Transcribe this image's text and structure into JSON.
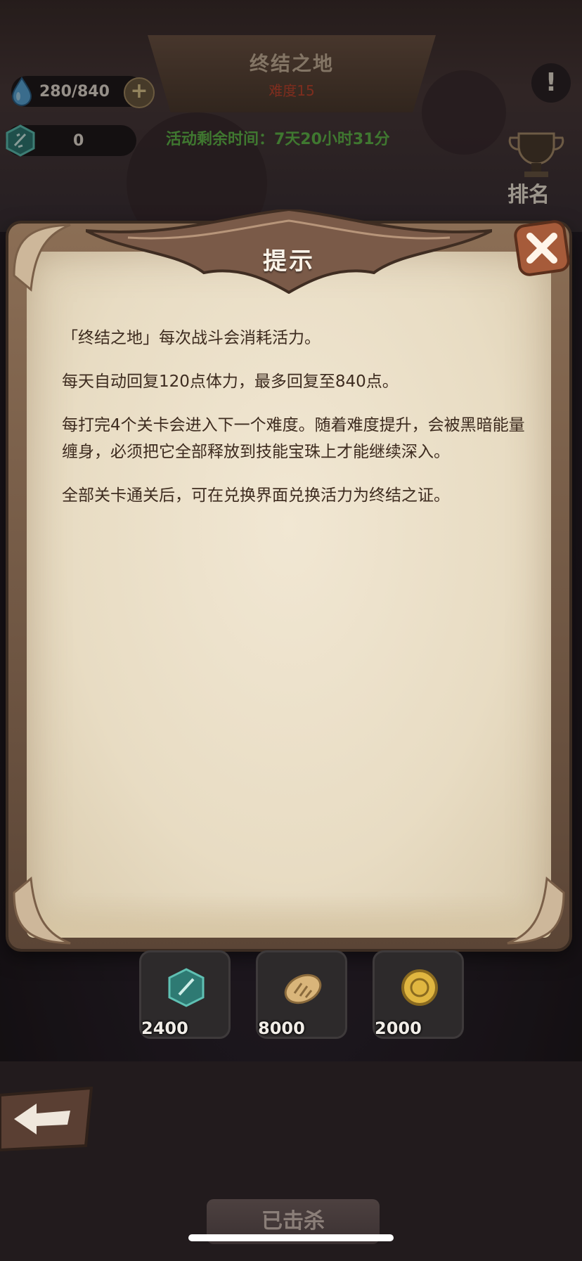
{
  "header": {
    "title": "终结之地",
    "difficulty": "难度15"
  },
  "resources": {
    "energy": "280/840",
    "energy_add": "+",
    "badge_count": "0"
  },
  "timer": "活动剩余时间：7天20小时31分",
  "alert_symbol": "!",
  "rank_label": "排名",
  "modal": {
    "title": "提示",
    "paragraphs": [
      "「终结之地」每次战斗会消耗活力。",
      "每天自动回复120点体力，最多回复至840点。",
      "每打完4个关卡会进入下一个难度。随着难度提升，会被黑暗能量缠身，必须把它全部释放到技能宝珠上才能继续深入。",
      "全部关卡通关后，可在兑换界面兑换活力为终结之证。"
    ]
  },
  "items": [
    {
      "icon": "gem-badge-icon",
      "value": "2400"
    },
    {
      "icon": "bread-icon",
      "value": "8000"
    },
    {
      "icon": "gold-coin-icon",
      "value": "2000"
    }
  ],
  "bottom_button": "已击杀",
  "colors": {
    "accent_red": "#c2452f",
    "timer_green": "#62b84a",
    "paper": "#efe4cf",
    "frame_brown": "#6e5444"
  }
}
